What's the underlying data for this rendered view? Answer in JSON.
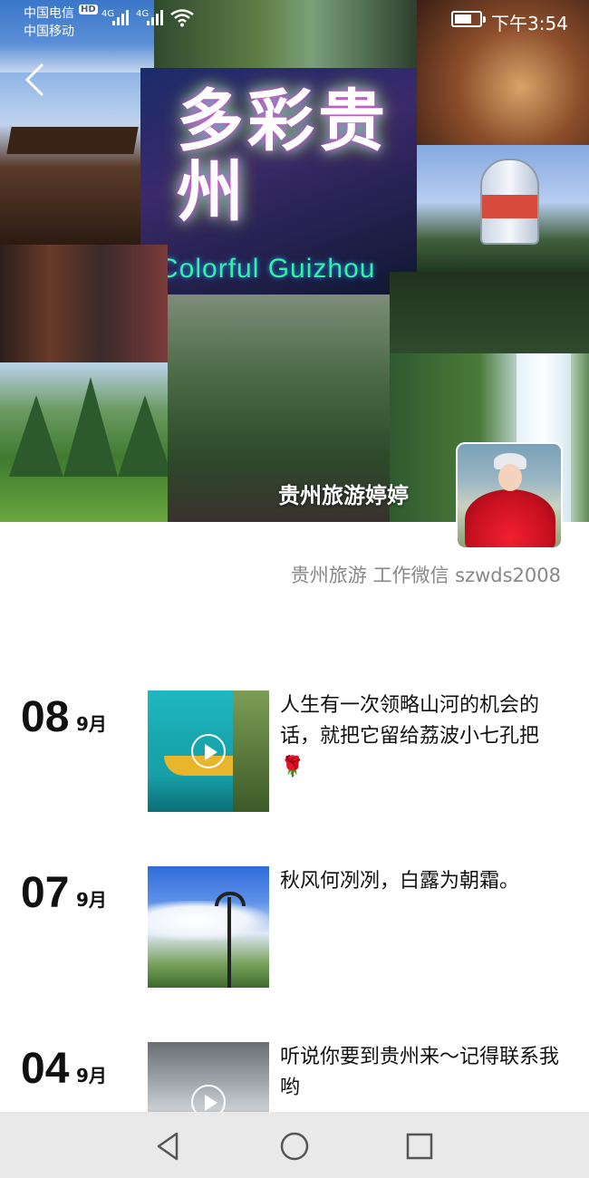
{
  "status_bar": {
    "carrier_1": "中国电信",
    "carrier_2": "中国移动",
    "hd_badge": "HD",
    "network_1": "4G",
    "network_2": "4G",
    "battery_level": 0.7,
    "time": "下午3:54"
  },
  "cover": {
    "logo_title": "多彩贵州",
    "logo_subtitle": "Colorful Guizhou",
    "profile_name": "贵州旅游婷婷",
    "signature": "贵州旅游 工作微信 szwds2008"
  },
  "posts": [
    {
      "day": "08",
      "month": "9月",
      "is_video": true,
      "text": "人生有一次领略山河的机会的话，就把它留给荔波小七孔把",
      "emoji": "🌹"
    },
    {
      "day": "07",
      "month": "9月",
      "is_video": false,
      "text": "秋风何冽冽，白露为朝霜。",
      "emoji": ""
    },
    {
      "day": "04",
      "month": "9月",
      "is_video": true,
      "text": "听说你要到贵州来～记得联系我哟",
      "emoji": ""
    }
  ],
  "icons": {
    "back": "chevron-left-icon",
    "play": "play-icon",
    "nav_back": "triangle-back-icon",
    "nav_home": "circle-home-icon",
    "nav_recent": "square-recent-icon"
  },
  "colors": {
    "nav_bar": "#e9e9e9",
    "signature_text": "#888888"
  }
}
